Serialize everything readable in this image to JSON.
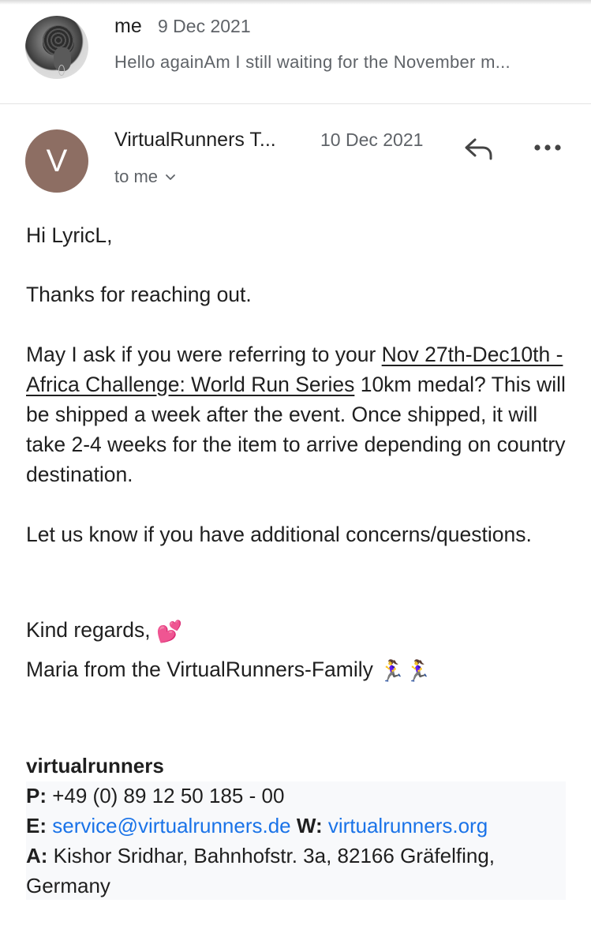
{
  "collapsed_message": {
    "sender": "me",
    "date": "9 Dec 2021",
    "snippet": "Hello againAm I still waiting for the November m..."
  },
  "expanded_message": {
    "avatar_letter": "V",
    "sender": "VirtualRunners T...",
    "date": "10 Dec 2021",
    "recipient": "to me",
    "icons": {
      "reply": "reply-icon",
      "more": "more-options-icon",
      "expand": "chevron-down-icon"
    },
    "colors": {
      "avatar_bg": "#8d6e63",
      "link": "#1a73e8"
    }
  },
  "body": {
    "greeting": "Hi LyricL,",
    "p1": "Thanks for reaching out.",
    "p2_before": "May I ask if you were referring to your ",
    "p2_link": "Nov 27th-Dec10th - Africa Challenge: World Run Series",
    "p2_after": " 10km medal? This will be shipped a week after the event. Once shipped, it will take 2-4 weeks for the item to arrive depending on country destination.",
    "p3": "Let us know if you have additional concerns/questions.",
    "closing": "Kind regards,",
    "closing_emoji": "💕",
    "sign_name": "Maria from the VirtualRunners-Family",
    "sign_emoji": "🏃‍♀️🏃‍♀️"
  },
  "signature": {
    "company": "virtualrunners",
    "phone_label": "P:",
    "phone": "+49 (0) 89 12 50 185 - 00",
    "email_label": "E:",
    "email": "service@virtualrunners.de",
    "web_label": "W:",
    "web": "virtualrunners.org",
    "address_label": "A:",
    "address": "Kishor Sridhar, Bahnhofstr. 3a, 82166 Gräfelfing, Germany"
  }
}
